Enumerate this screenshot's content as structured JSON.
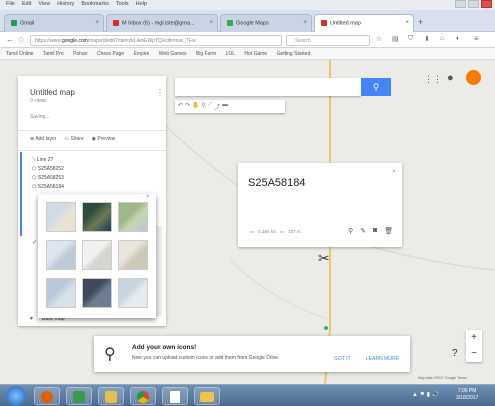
{
  "menubar": [
    "File",
    "Edit",
    "View",
    "History",
    "Bookmarks",
    "Tools",
    "Help"
  ],
  "tabs": [
    {
      "label": "Gmail",
      "color": "#1f9d5a"
    },
    {
      "label": "M Inbox (6) - mgl.iste@gma...",
      "color": "#d93025"
    },
    {
      "label": "Google Maps",
      "color": "#34a853"
    },
    {
      "label": "Untitled map",
      "color": "#d93025"
    }
  ],
  "address": {
    "host": "https://www.",
    "domain": "google.com",
    "path": "/maps/d/edit?mid=zkLAmEWpTQ/edit=true_TEw",
    "search_placeholder": "Search"
  },
  "bookmarks": [
    "Tamil Online",
    "Tamil Pro",
    "Pohan",
    "Chess Page",
    "Empire",
    "Web Games",
    "Big Farm",
    "LOL",
    "Hot Game",
    "Getting Started"
  ],
  "panel": {
    "title": "Untitled map",
    "views": "0 views",
    "saving": "Saving...",
    "actions": [
      "Add layer",
      "Share",
      "Preview"
    ],
    "layer_items": [
      "Line 27",
      "S25A58252",
      "S25A58253",
      "S25A58184"
    ],
    "base_map_label": "Base map"
  },
  "card": {
    "title": "S25A58184",
    "meta_left": "0.384 ha",
    "meta_right": "337 m"
  },
  "toast": {
    "heading": "Add your own icons!",
    "body": "Now you can upload custom icons or add them from Google Drive.",
    "got_it": "GOT IT",
    "learn_more": "LEARN MORE"
  },
  "map_footer": "Map data ©2017 Google   Terms",
  "clock": {
    "time": "7:05 PM",
    "date": "3/18/2017"
  },
  "colors": {
    "accent": "#4285f4",
    "avatar": "#f57c00",
    "toast_link": "#4285f4"
  }
}
